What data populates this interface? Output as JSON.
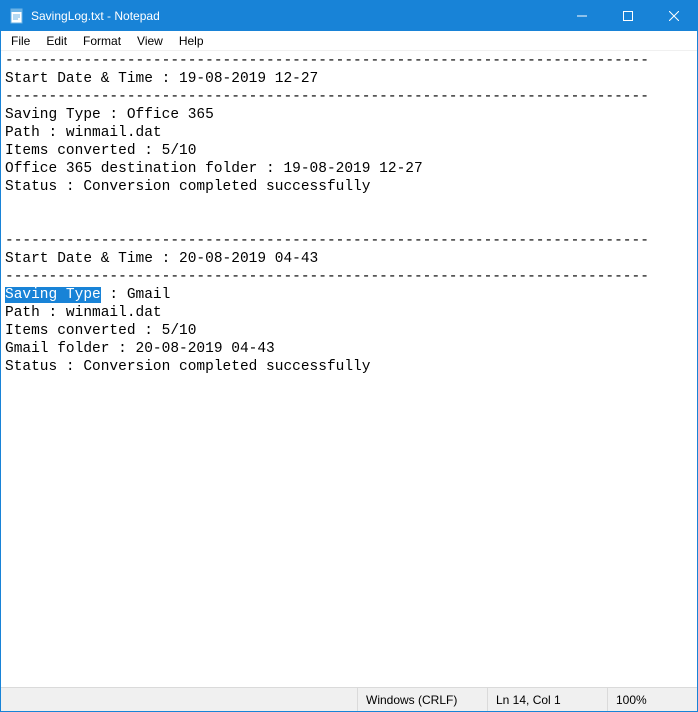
{
  "window": {
    "title": "SavingLog.txt - Notepad"
  },
  "menubar": {
    "file": "File",
    "edit": "Edit",
    "format": "Format",
    "view": "View",
    "help": "Help"
  },
  "content": {
    "divider": "--------------------------------------------------------------------------",
    "block1": {
      "start": "Start Date & Time : 19-08-2019 12-27",
      "typeLine": "Saving Type : Office 365",
      "path": "Path : winmail.dat",
      "items": "Items converted : 5/10",
      "dest": "Office 365 destination folder : 19-08-2019 12-27",
      "status": "Status : Conversion completed successfully"
    },
    "block2": {
      "start": "Start Date & Time : 20-08-2019 04-43",
      "typeSel": "Saving Type",
      "typeRest": " : Gmail",
      "path": "Path : winmail.dat",
      "items": "Items converted : 5/10",
      "dest": "Gmail folder : 20-08-2019 04-43",
      "status": "Status : Conversion completed successfully"
    }
  },
  "statusbar": {
    "encoding": "Windows (CRLF)",
    "position": "Ln 14, Col 1",
    "zoom": "100%"
  }
}
